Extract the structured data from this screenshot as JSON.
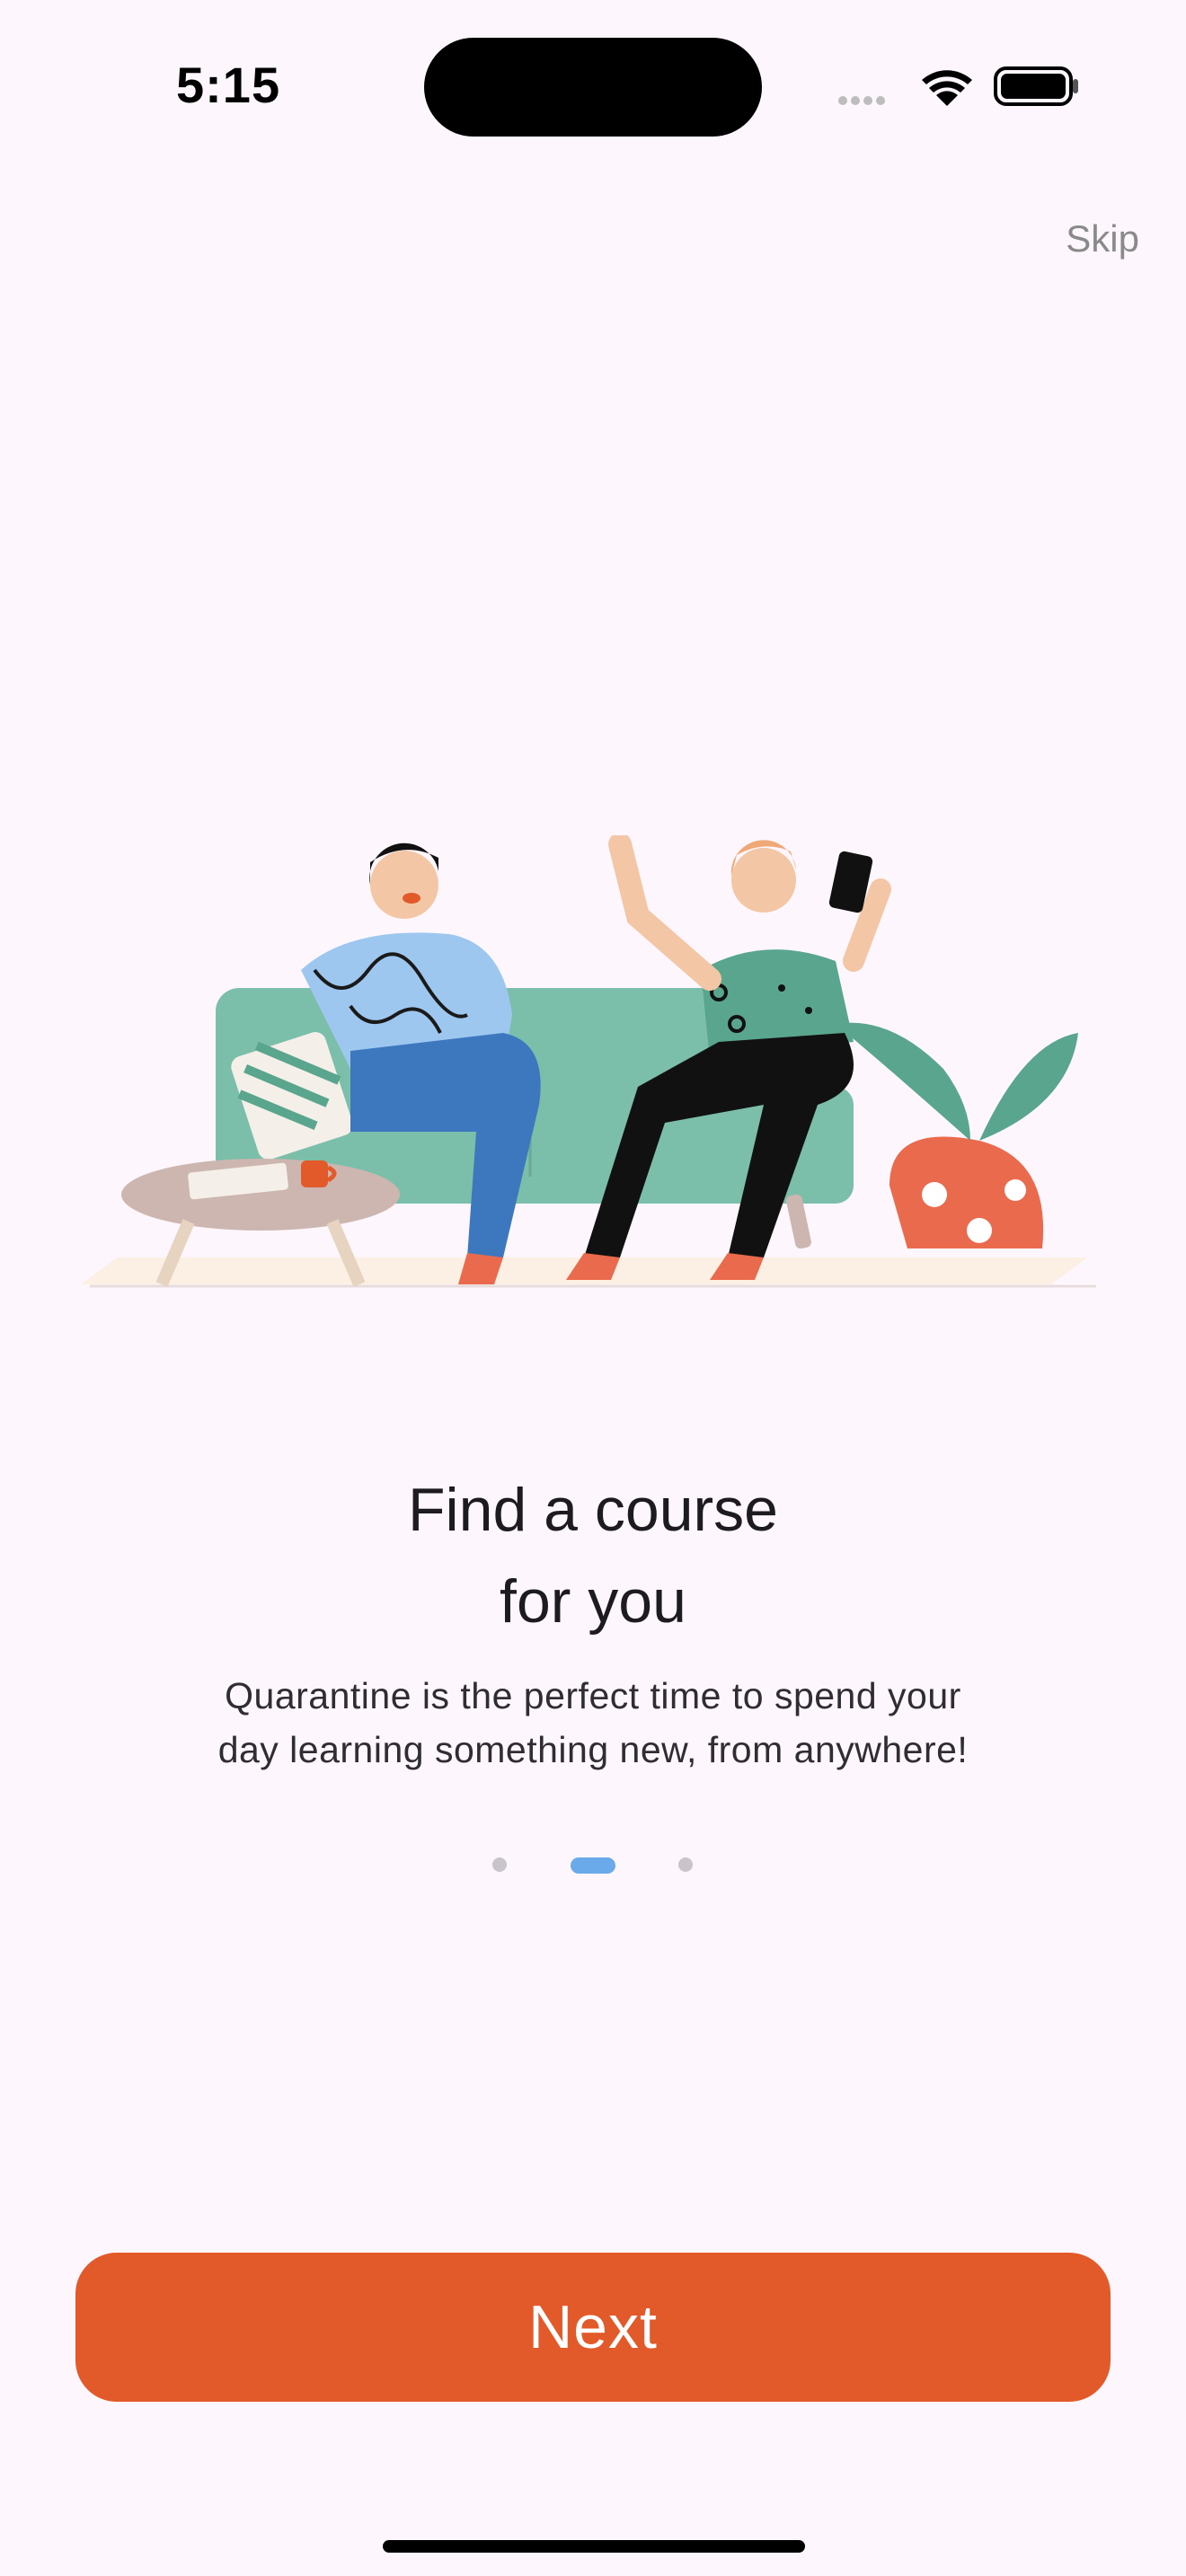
{
  "status_bar": {
    "time": "5:15",
    "icons": [
      "cellular-signal-icon",
      "wifi-icon",
      "battery-icon"
    ]
  },
  "header": {
    "skip_label": "Skip"
  },
  "onboarding": {
    "illustration": "two-people-on-sofa-illustration",
    "title_line1": "Find a course",
    "title_line2": "for you",
    "description_line1": "Quarantine is the perfect time to spend your",
    "description_line2": "day learning something new, from anywhere!",
    "page_count": 3,
    "current_page": 2
  },
  "footer": {
    "next_label": "Next"
  },
  "colors": {
    "background": "#fdf7fd",
    "accent": "#e2592a",
    "page_indicator_active": "#6aa9ea",
    "page_indicator_inactive": "#c9c4cb"
  }
}
